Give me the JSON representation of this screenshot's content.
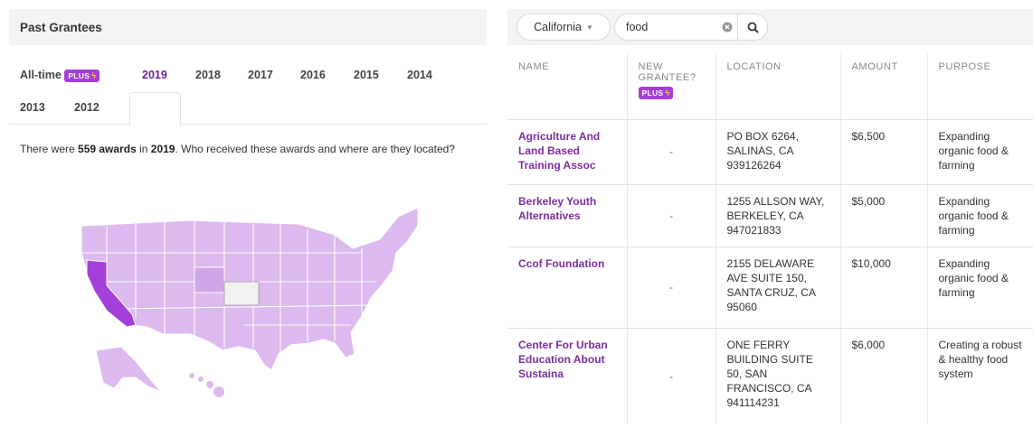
{
  "past_grantees": {
    "title": "Past Grantees",
    "tabs": {
      "alltime": "All-time",
      "plus": "PLUS",
      "y2019": "2019",
      "y2018": "2018",
      "y2017": "2017",
      "y2016": "2016",
      "y2015": "2015",
      "y2014": "2014",
      "y2013": "2013",
      "y2012": "2012"
    },
    "active_tab": "2019",
    "summary": {
      "prefix": "There were ",
      "count": "559 awards",
      "mid": " in ",
      "year": "2019",
      "suffix": ". Who received these awards and where are they located?"
    },
    "map": {
      "highlight_state": "California",
      "highlight_color": "#a43fd9",
      "base_color": "#dcb9ee",
      "null_color": "#f2f2f2"
    }
  },
  "filters": {
    "state": "California",
    "search_value": "food",
    "clear_icon": "clear-circle-icon",
    "search_icon": "magnifier-icon"
  },
  "table": {
    "headers": {
      "name": "NAME",
      "new_grantee_1": "NEW",
      "new_grantee_2": "GRANTEE?",
      "plus": "PLUS",
      "location": "LOCATION",
      "amount": "AMOUNT",
      "purpose": "PURPOSE"
    },
    "rows": [
      {
        "name": "Agriculture And Land Based Training Assoc",
        "new": "-",
        "location": "PO BOX 6264, SALINAS, CA 939126264",
        "amount": "$6,500",
        "purpose": "Expanding organic food & farming"
      },
      {
        "name": "Berkeley Youth Alternatives",
        "new": "-",
        "location": "1255 ALLSON WAY, BERKELEY, CA 947021833",
        "amount": "$5,000",
        "purpose": "Expanding organic food & farming"
      },
      {
        "name": "Ccof Foundation",
        "new": "-",
        "location": "2155 DELAWARE AVE SUITE 150, SANTA CRUZ, CA 95060",
        "amount": "$10,000",
        "purpose": "Expanding organic food & farming"
      },
      {
        "name": "Center For Urban Education About Sustaina",
        "new": "-",
        "location": "ONE FERRY BUILDING SUITE 50, SAN FRANCISCO, CA 941114231",
        "amount": "$6,000",
        "purpose": "Creating a robust & healthy food system"
      }
    ]
  }
}
